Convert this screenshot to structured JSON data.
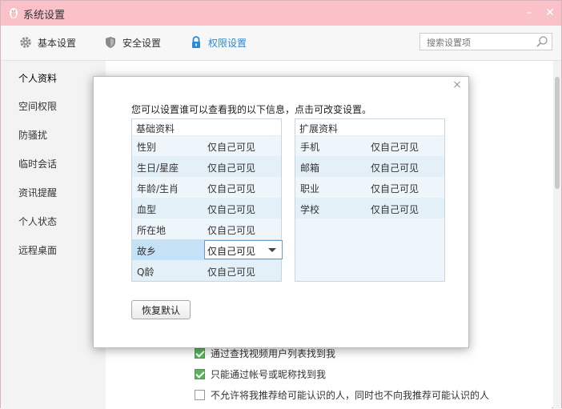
{
  "window": {
    "title": "系统设置",
    "colors": {
      "titlebar": "#fbc1c9",
      "accent": "#2a8ad6",
      "check_on": "#5bb35b"
    }
  },
  "tabs": [
    {
      "label": "基本设置",
      "icon": "gear-icon",
      "active": false
    },
    {
      "label": "安全设置",
      "icon": "shield-icon",
      "active": false
    },
    {
      "label": "权限设置",
      "icon": "lock-icon",
      "active": true
    }
  ],
  "search": {
    "placeholder": "搜索设置项"
  },
  "sidebar": {
    "items": [
      {
        "label": "个人资料",
        "active": true
      },
      {
        "label": "空间权限",
        "active": false
      },
      {
        "label": "防骚扰",
        "active": false
      },
      {
        "label": "临时会话",
        "active": false
      },
      {
        "label": "资讯提醒",
        "active": false
      },
      {
        "label": "个人状态",
        "active": false
      },
      {
        "label": "远程桌面",
        "active": false
      }
    ]
  },
  "content": {
    "checkboxes": [
      {
        "label": "通过查找视频用户列表找到我",
        "checked": true
      },
      {
        "label": "只能通过帐号或昵称找到我",
        "checked": true
      },
      {
        "label": "不允许将我推荐给可能认识的人，同时也不向我推荐可能认识的人",
        "checked": false
      }
    ]
  },
  "dialog": {
    "close": "×",
    "message": "您可以设置谁可以查看我的以下信息，点击可改变设置。",
    "basic": {
      "header": "基础资料",
      "rows": [
        {
          "label": "性别",
          "value": "仅自己可见"
        },
        {
          "label": "生日/星座",
          "value": "仅自己可见"
        },
        {
          "label": "年龄/生肖",
          "value": "仅自己可见"
        },
        {
          "label": "血型",
          "value": "仅自己可见"
        },
        {
          "label": "所在地",
          "value": "仅自己可见"
        },
        {
          "label": "故乡",
          "value": "仅自己可见"
        },
        {
          "label": "Q龄",
          "value": "仅自己可见"
        }
      ]
    },
    "extended": {
      "header": "扩展资料",
      "rows": [
        {
          "label": "手机",
          "value": "仅自己可见"
        },
        {
          "label": "邮箱",
          "value": "仅自己可见"
        },
        {
          "label": "职业",
          "value": "仅自己可见"
        },
        {
          "label": "学校",
          "value": "仅自己可见"
        }
      ]
    },
    "restore_label": "恢复默认"
  }
}
